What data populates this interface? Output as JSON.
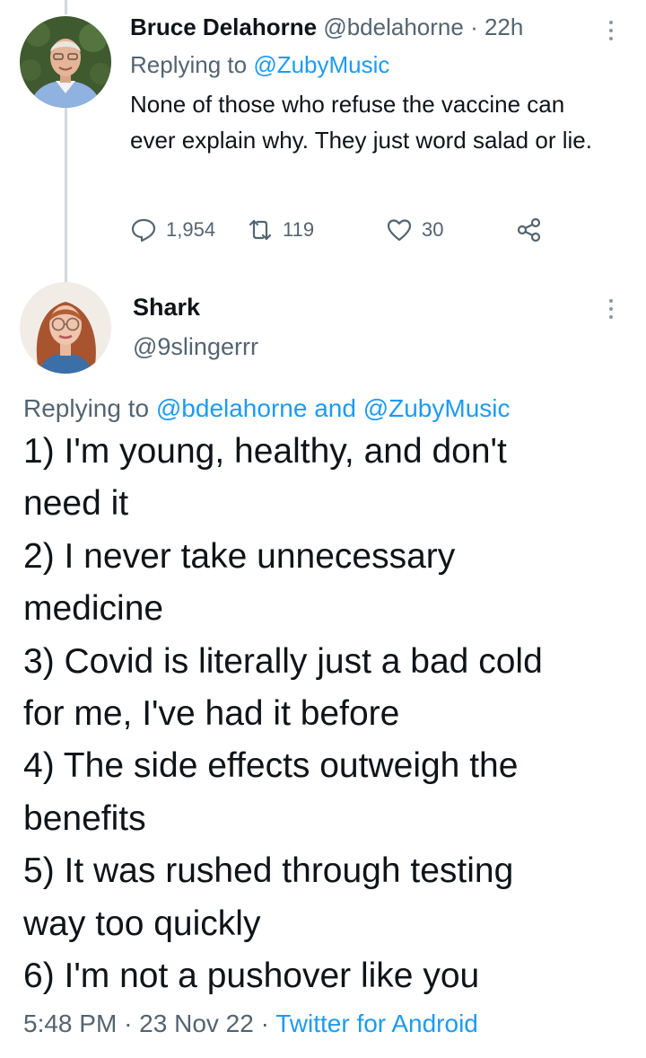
{
  "reply_tweet": {
    "author_name": "Bruce Delahorne",
    "author_handle": "@bdelahorne",
    "separator": "·",
    "time_ago": "22h",
    "replying_prefix": "Replying to",
    "replying_to": "@ZubyMusic",
    "text": "None of those who refuse the vaccine can ever explain why. They just word salad or lie.",
    "reply_count": "1,954",
    "retweet_count": "119",
    "like_count": "30",
    "avatar_icon": "profile-photo-man",
    "action_icons": [
      "reply-icon",
      "retweet-icon",
      "like-icon",
      "share-icon"
    ]
  },
  "main_tweet": {
    "author_name": "Shark",
    "author_handle": "@9slingerrr",
    "replying_prefix": "Replying to",
    "replying_to_1": "@bdelahorne",
    "replying_joiner": "and",
    "replying_to_2": "@ZubyMusic",
    "lines": [
      "1) I'm young, healthy, and don't",
      "need it",
      "2) I never take unnecessary",
      "medicine",
      "3) Covid is literally just a bad cold",
      "for me, I've had it before",
      "4) The side effects outweigh the",
      "benefits",
      "5) It was rushed through testing",
      "way too quickly",
      "6) I'm not a pushover like you"
    ],
    "time": "5:48 PM",
    "separator": "·",
    "date": "23 Nov 22",
    "source": "Twitter for Android",
    "avatar_icon": "profile-photo-woman"
  },
  "colors": {
    "text_primary": "#0f1419",
    "text_secondary": "#536471",
    "link_blue": "#1d9bf0",
    "thread_line": "#cfd9de"
  }
}
